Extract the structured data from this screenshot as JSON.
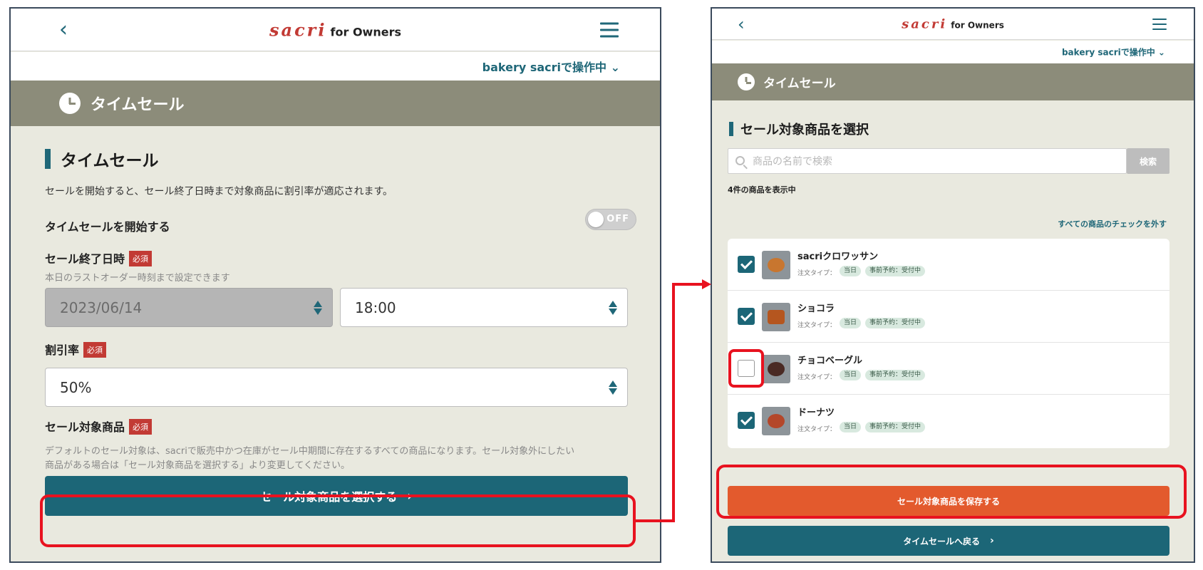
{
  "colors": {
    "teal": "#1c6677",
    "orange": "#e35a2d",
    "badge_red": "#c23a34",
    "band": "#8c8c7a",
    "highlight": "#e8121f",
    "bg": "#e9e9df"
  },
  "left": {
    "header": {
      "back_icon": "chevron-left-icon",
      "logo_main": "sacri",
      "logo_sub": "for Owners",
      "menu_icon": "hamburger-icon"
    },
    "operator": "bakery sacriで操作中 ⌄",
    "band_title": "タイムセール",
    "section_title": "タイムセール",
    "description": "セールを開始すると、セール終了日時まで対象商品に割引率が適応されます。",
    "start_label": "タイムセールを開始する",
    "toggle_text": "OFF",
    "end_label": "セール終了日時",
    "required": "必須",
    "end_hint": "本日のラストオーダー時刻まで設定できます",
    "date_value": "2023/06/14",
    "time_value": "18:00",
    "discount_label": "割引率",
    "discount_value": "50%",
    "products_label": "セール対象商品",
    "products_note_1": "デフォルトのセール対象は、sacriで販売中かつ在庫がセール中期間に存在するすべての商品になります。セール対象外にしたい",
    "products_note_2": "商品がある場合は「セール対象商品を選択する」より変更してください。",
    "select_button": "セール対象商品を選択する",
    "chevron": "›"
  },
  "right": {
    "header": {
      "back_icon": "chevron-left-icon",
      "logo_main": "sacri",
      "logo_sub": "for Owners",
      "menu_icon": "hamburger-icon"
    },
    "operator": "bakery sacriで操作中 ⌄",
    "band_title": "タイムセール",
    "section_title": "セール対象商品を選択",
    "search_placeholder": "商品の名前で検索",
    "search_button": "検索",
    "count_text": "4件の商品を表示中",
    "uncheck_all": "すべての商品のチェックを外す",
    "order_type_label": "注文タイプ：",
    "tag_today": "当日",
    "tag_preorder": "事前予約：受付中",
    "products": [
      {
        "name": "sacriクロワッサン",
        "checked": true
      },
      {
        "name": "ショコラ",
        "checked": true
      },
      {
        "name": "チョコベーグル",
        "checked": false
      },
      {
        "name": "ドーナツ",
        "checked": true
      }
    ],
    "save_button": "セール対象商品を保存する",
    "back_button": "タイムセールへ戻る",
    "chevron": "›"
  }
}
